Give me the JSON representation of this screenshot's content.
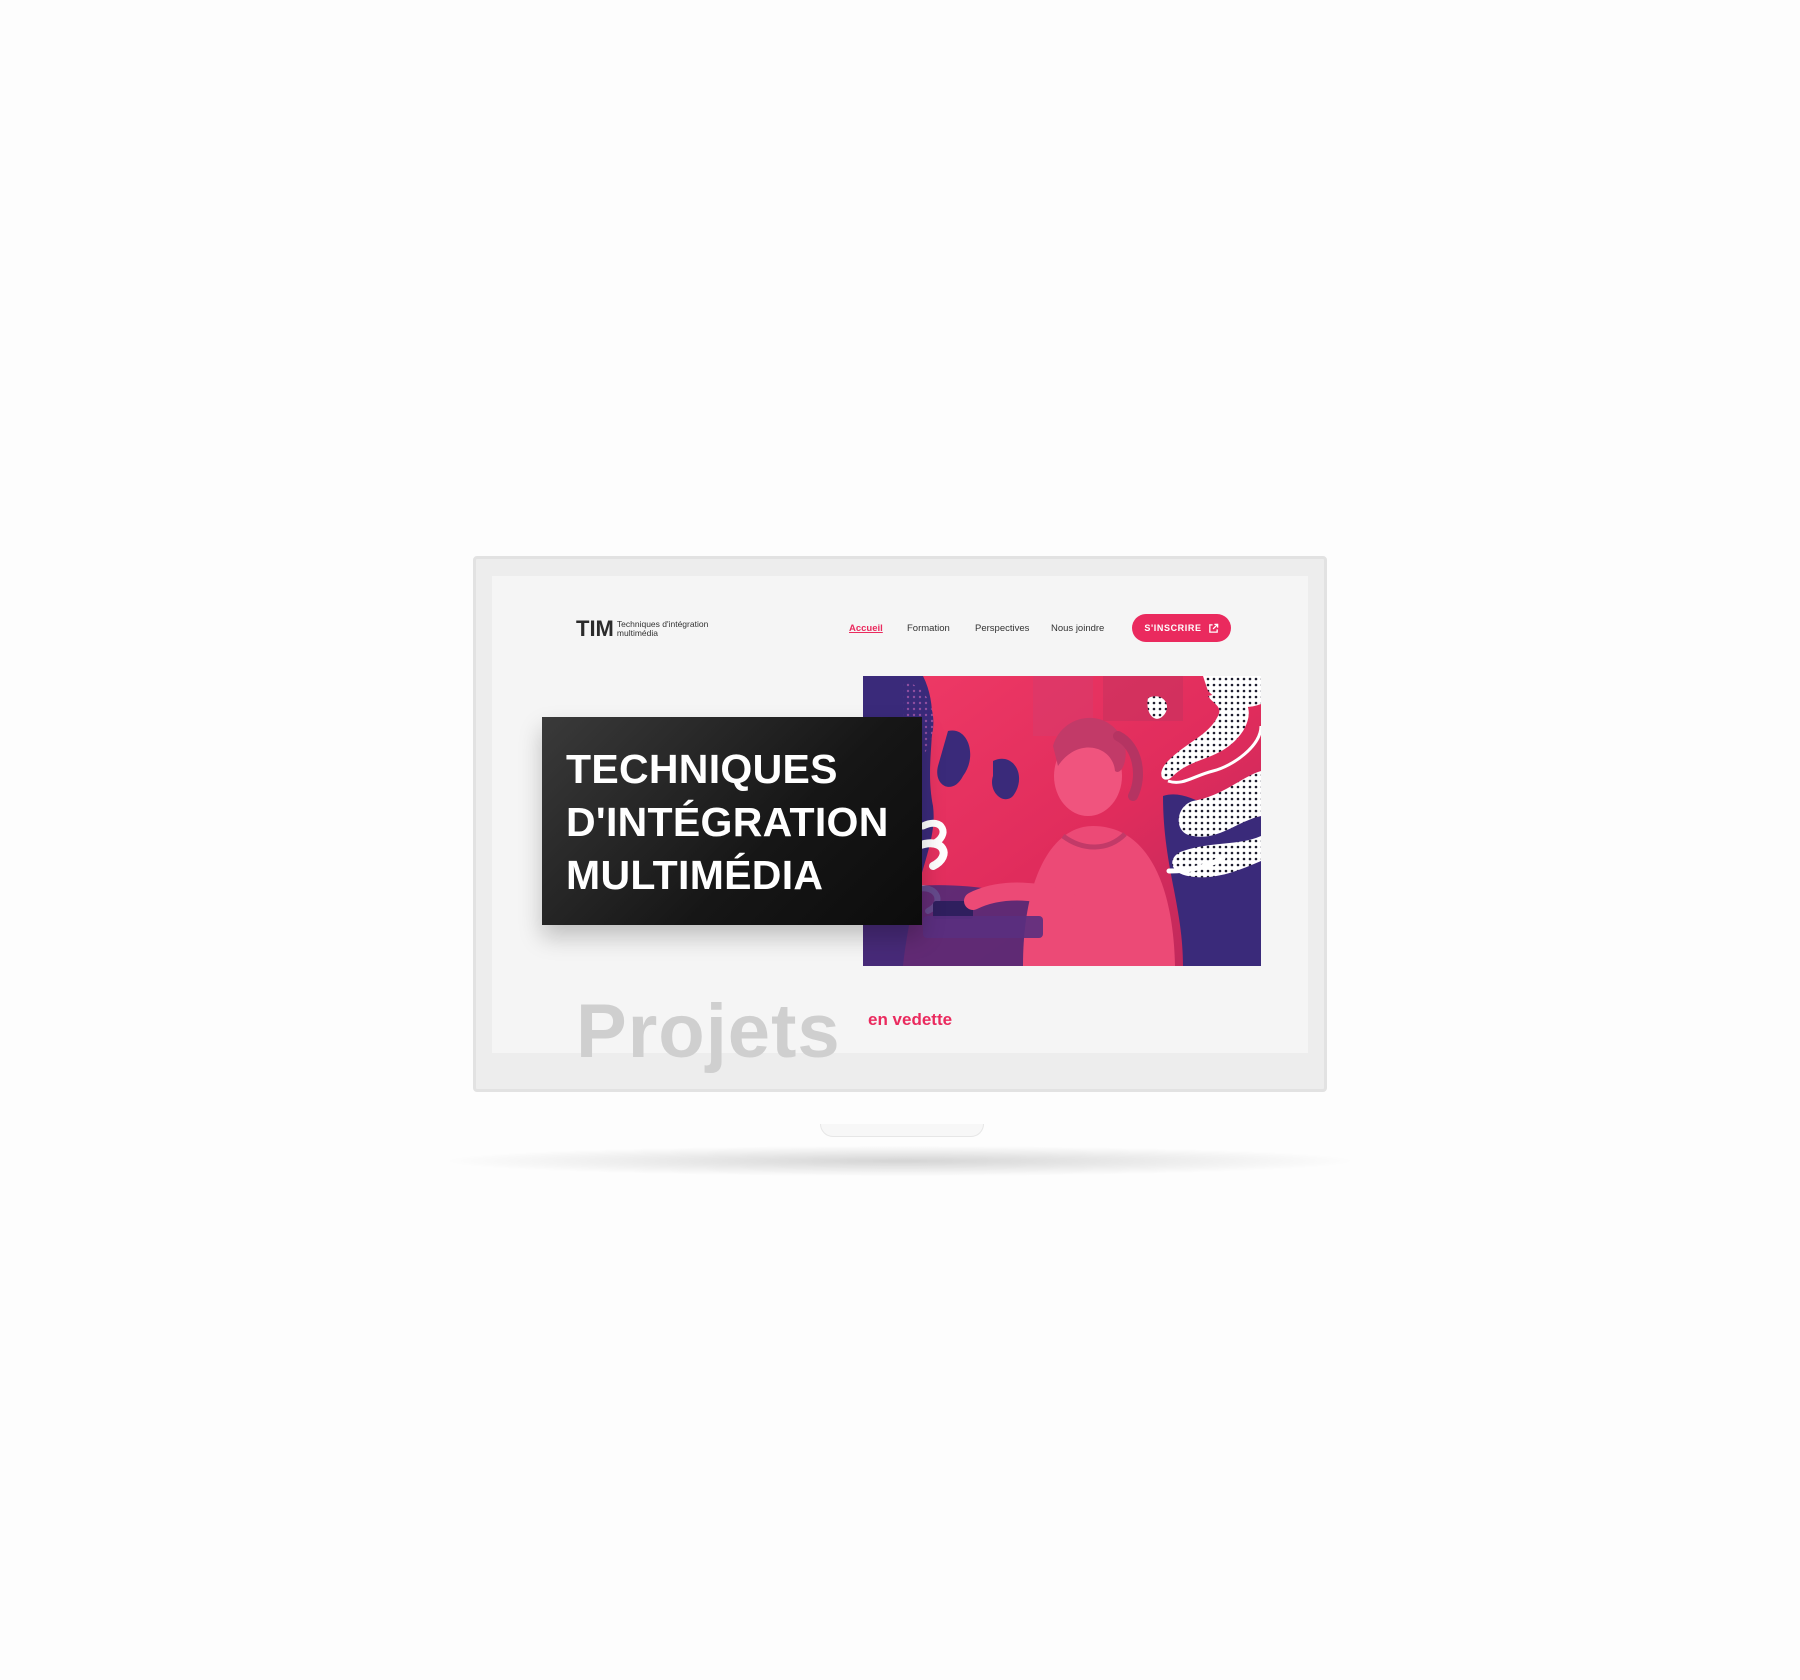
{
  "colors": {
    "accent": "#ea2a5e",
    "title_box": "#1a1a1a",
    "screen_bg": "#f5f5f5",
    "hero_magenta": "#e8305c",
    "hero_purple": "#3a2a7a"
  },
  "brand": {
    "mark": "TIM",
    "name": "Techniques d'intégration multimédia"
  },
  "nav": {
    "items": [
      {
        "label": "Accueil",
        "active": true
      },
      {
        "label": "Formation",
        "active": false
      },
      {
        "label": "Perspectives",
        "active": false
      },
      {
        "label": "Nous joindre",
        "active": false
      }
    ],
    "cta_label": "S'INSCRIRE",
    "cta_icon": "external-link-icon"
  },
  "hero": {
    "title_lines": [
      "TECHNIQUES",
      "D'INTÉGRATION",
      "MULTIMÉDIA"
    ],
    "image": "students-at-computers-duotone-photo"
  },
  "featured": {
    "title": "Projets",
    "subtitle": "en vedette"
  }
}
